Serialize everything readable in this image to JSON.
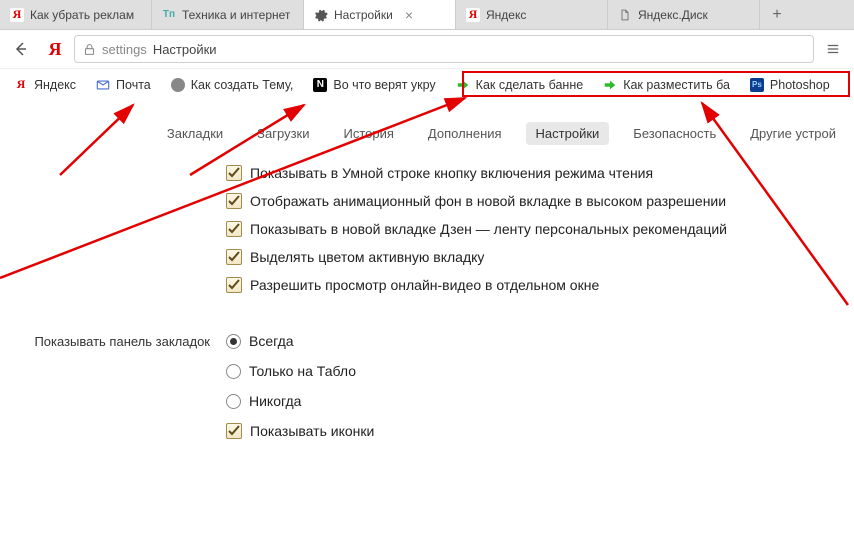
{
  "tabs": [
    {
      "title": "Как убрать реклам",
      "favicon": "y"
    },
    {
      "title": "Техника и интернет",
      "favicon": "tp"
    },
    {
      "title": "Настройки",
      "favicon": "gear",
      "active": true
    },
    {
      "title": "Яндекс",
      "favicon": "y"
    },
    {
      "title": "Яндекс.Диск",
      "favicon": "doc"
    }
  ],
  "address": {
    "prefix": "settings",
    "text": "Настройки"
  },
  "bookmarks": [
    {
      "title": "Яндекс",
      "favicon": "y"
    },
    {
      "title": "Почта",
      "favicon": "mail"
    },
    {
      "title": "Как создать Тему,",
      "favicon": "generic"
    },
    {
      "title": "Во что верят укру",
      "favicon": "n"
    },
    {
      "title": "Как сделать банне",
      "favicon": "green"
    },
    {
      "title": "Как разместить ба",
      "favicon": "green"
    },
    {
      "title": "Photoshop",
      "favicon": "ps"
    }
  ],
  "nav": {
    "items": [
      "Закладки",
      "Загрузки",
      "История",
      "Дополнения",
      "Настройки",
      "Безопасность",
      "Другие устрой"
    ],
    "active": "Настройки"
  },
  "checks": [
    "Показывать в Умной строке кнопку включения режима чтения",
    "Отображать анимационный фон в новой вкладке в высоком разрешении",
    "Показывать в новой вкладке Дзен — ленту персональных рекомендаций",
    "Выделять цветом активную вкладку",
    "Разрешить просмотр онлайн-видео в отдельном окне"
  ],
  "section_label": "Показывать панель закладок",
  "radios": [
    "Всегда",
    "Только на Табло",
    "Никогда"
  ],
  "radio_selected": 0,
  "check_show_icons": "Показывать иконки"
}
